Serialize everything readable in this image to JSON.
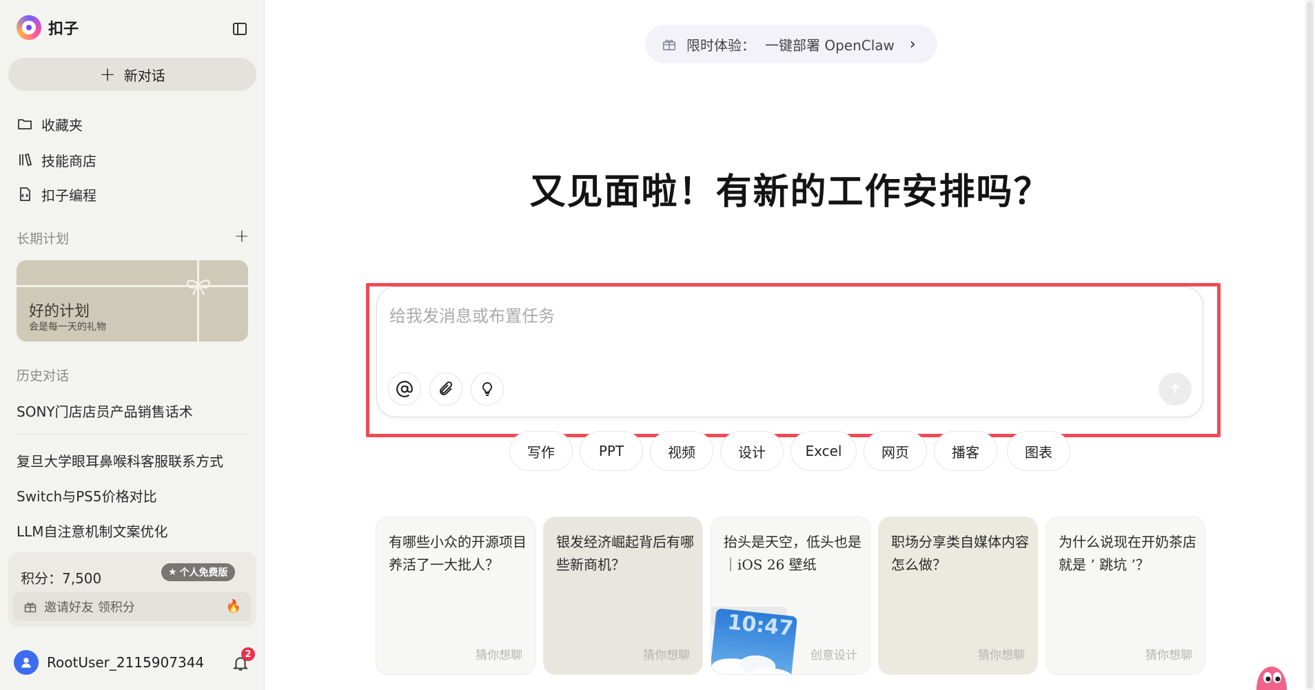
{
  "app": {
    "name": "扣子"
  },
  "sidebar": {
    "new_chat_label": "新对话",
    "nav": [
      {
        "label": "收藏夹",
        "icon": "folder-icon"
      },
      {
        "label": "技能商店",
        "icon": "library-icon"
      },
      {
        "label": "扣子编程",
        "icon": "code-file-icon"
      }
    ],
    "plans_title": "长期计划",
    "plan_card": {
      "title": "好的计划",
      "subtitle": "会是每一天的礼物"
    },
    "history_title": "历史对话",
    "history": [
      "SONY门店店员产品销售话术",
      "复旦大学眼耳鼻喉科客服联系方式",
      "Switch与PS5价格对比",
      "LLM自注意机制文案优化"
    ],
    "points_label": "积分：7,500",
    "plan_badge": "个人免费版",
    "invite_label": "邀请好友 领积分",
    "user_name": "RootUser_2115907344",
    "notification_count": "2"
  },
  "main": {
    "banner_label": "限时体验：",
    "banner_link": "一键部署 OpenClaw",
    "headline": "又见面啦！有新的工作安排吗？",
    "input_placeholder": "给我发消息或布置任务",
    "chips": [
      "写作",
      "PPT",
      "视频",
      "设计",
      "Excel",
      "网页",
      "播客",
      "图表"
    ],
    "cards": [
      {
        "text": "有哪些小众的开源项目养活了一大批人？",
        "tag": "猜你想聊"
      },
      {
        "text": "银发经济崛起背后有哪些新商机？",
        "tag": "猜你想聊"
      },
      {
        "text": "抬头是天空，低头也是｜iOS 26 壁纸",
        "tag": "创意设计"
      },
      {
        "text": "职场分享类自媒体内容怎么做？",
        "tag": "猜你想聊"
      },
      {
        "text": "为什么说现在开奶茶店就是 ’ 跳坑 ’？",
        "tag": "猜你想聊"
      }
    ],
    "card_image_text": "10:47"
  },
  "colors": {
    "accent_highlight": "#ef4b55",
    "sidebar_bg": "#f3f3f0",
    "user_avatar": "#3d6cf0",
    "badge_red": "#e8324a"
  }
}
